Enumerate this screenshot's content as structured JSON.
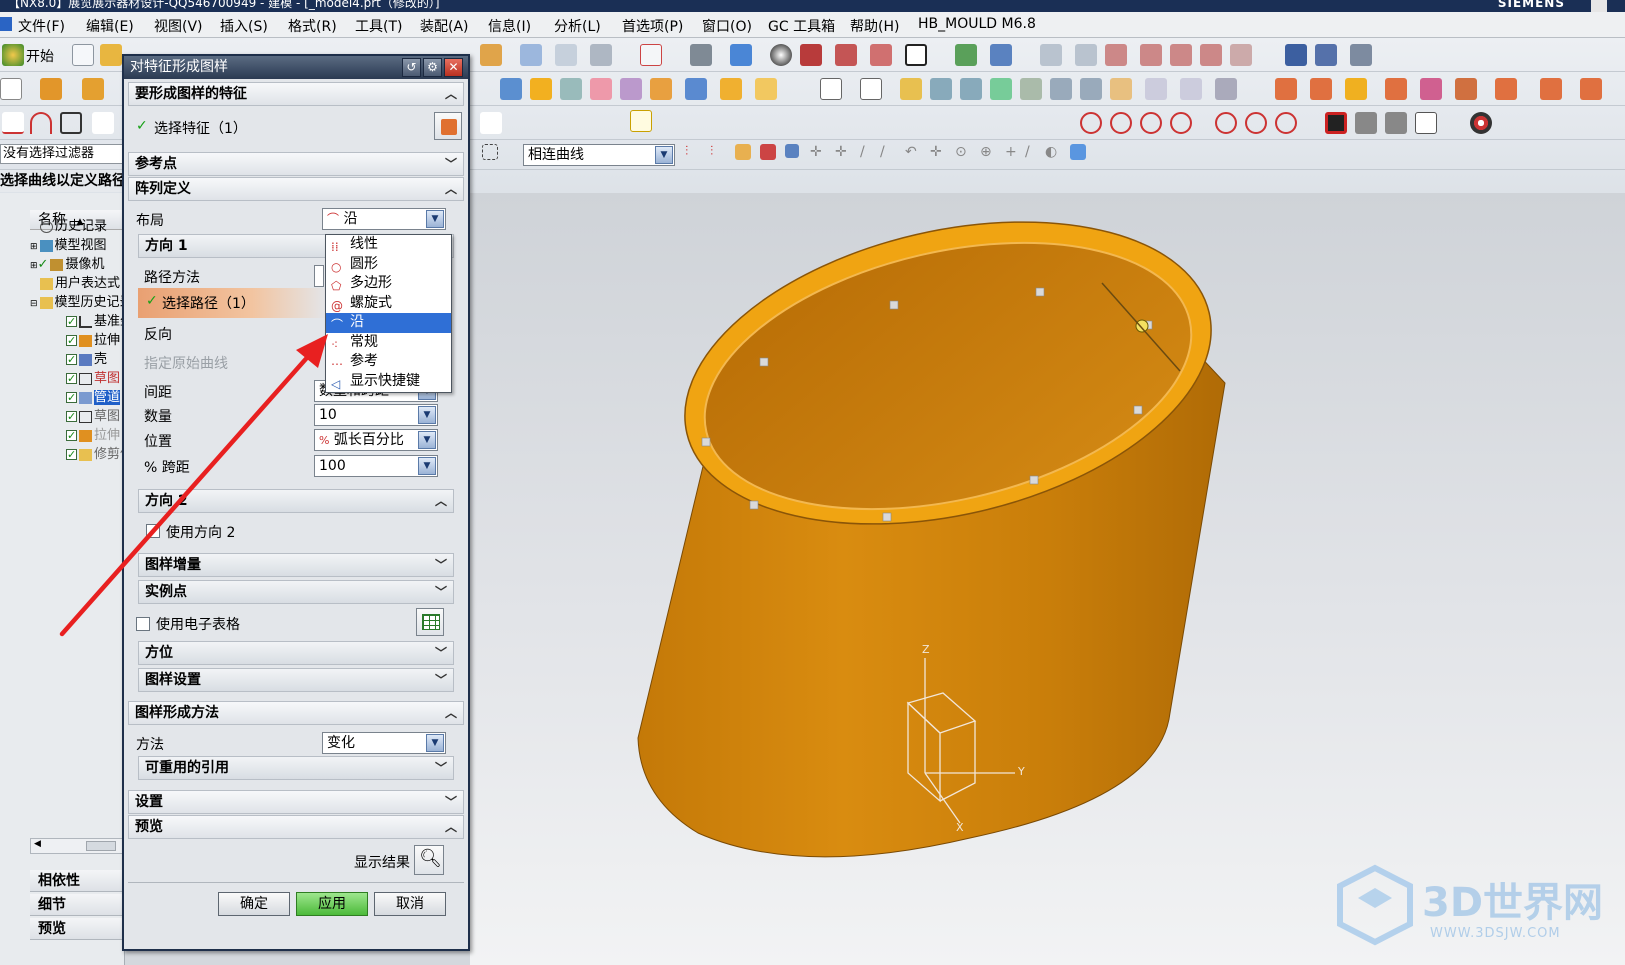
{
  "window": {
    "title": "【NX8.0】展览展示器材设计-QQ546700949 - 建模 - [_model4.prt（修改的）]",
    "brand": "SIEMENS"
  },
  "menubar": {
    "items": [
      "文件(F)",
      "编辑(E)",
      "视图(V)",
      "插入(S)",
      "格式(R)",
      "工具(T)",
      "装配(A)",
      "信息(I)",
      "分析(L)",
      "首选项(P)",
      "窗口(O)",
      "GC 工具箱",
      "帮助(H)",
      "HB_MOULD M6.8"
    ]
  },
  "toolbar": {
    "start_label": "开始",
    "curve_rule": "相连曲线"
  },
  "left_panel": {
    "filter": "没有选择过滤器",
    "prompt": "选择曲线以定义路径",
    "column_header": "名称",
    "tree": [
      {
        "label": "历史记录",
        "checked": false
      },
      {
        "label": "模型视图",
        "checked": false
      },
      {
        "label": "摄像机",
        "checked": true
      },
      {
        "label": "用户表达式",
        "checked": false
      },
      {
        "label": "模型历史记录",
        "checked": false
      },
      {
        "label": "基准坐标系",
        "checked": true
      },
      {
        "label": "拉伸",
        "checked": true
      },
      {
        "label": "壳",
        "checked": true
      },
      {
        "label": "草图",
        "checked": true
      },
      {
        "label": "管道",
        "checked": true
      },
      {
        "label": "草图",
        "checked": true
      },
      {
        "label": "拉伸",
        "checked": true
      },
      {
        "label": "修剪体",
        "checked": true
      }
    ],
    "bottom_sections": [
      "相依性",
      "细节",
      "预览"
    ]
  },
  "dialog": {
    "title": "对特征形成图样",
    "sec_features": "要形成图样的特征",
    "select_feature": "选择特征（1）",
    "sec_refpoint": "参考点",
    "sec_array_def": "阵列定义",
    "layout_label": "布局",
    "layout_value": "沿",
    "dir1": "方向 1",
    "path_method_label": "路径方法",
    "select_path": "选择路径（1）",
    "reverse_label": "反向",
    "origin_curve_label": "指定原始曲线",
    "spacing_label": "间距",
    "spacing_value": "数量和跨距",
    "count_label": "数量",
    "count_value": "10",
    "position_label": "位置",
    "position_value": "弧长百分比",
    "span_label": "% 跨距",
    "span_value": "100",
    "dir2": "方向 2",
    "use_dir2": "使用方向 2",
    "pattern_increment": "图样增量",
    "instance_points": "实例点",
    "use_spreadsheet": "使用电子表格",
    "orientation": "方位",
    "pattern_settings": "图样设置",
    "sec_method": "图样形成方法",
    "method_label": "方法",
    "method_value": "变化",
    "reusable_refs": "可重用的引用",
    "sec_settings": "设置",
    "sec_preview": "预览",
    "show_result": "显示结果",
    "ok": "确定",
    "apply": "应用",
    "cancel": "取消"
  },
  "layout_dropdown": {
    "options": [
      "线性",
      "圆形",
      "多边形",
      "螺旋式",
      "沿",
      "常规",
      "参考",
      "显示快捷键"
    ],
    "selected": "沿"
  },
  "viewport": {
    "axis_labels": [
      "Z",
      "Y",
      "X"
    ],
    "model_color": "#d88a0a"
  },
  "watermark": {
    "text": "3D世界网",
    "url": "WWW.3DSJW.COM"
  }
}
